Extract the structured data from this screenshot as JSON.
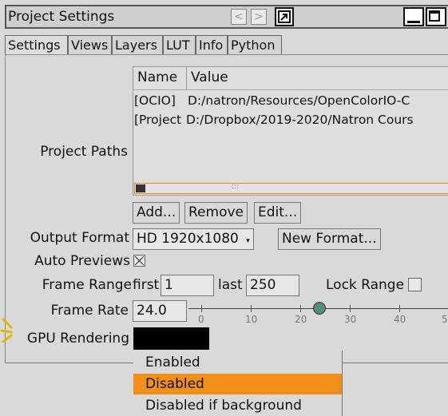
{
  "window": {
    "title": "Project Settings"
  },
  "tabs": [
    "Settings",
    "Views",
    "Layers",
    "LUT",
    "Info",
    "Python"
  ],
  "project_paths": {
    "label": "Project Paths",
    "headers": [
      "Name",
      "Value"
    ],
    "rows": [
      {
        "name": "[OCIO]",
        "value": "D:/natron/Resources/OpenColorIO-C"
      },
      {
        "name": "[Project",
        "value": "D:/Dropbox/2019-2020/Natron Cours"
      }
    ],
    "buttons": {
      "add": "Add...",
      "remove": "Remove",
      "edit": "Edit..."
    }
  },
  "output_format": {
    "label": "Output Format",
    "value": "HD 1920x1080",
    "new_button": "New Format..."
  },
  "auto_previews": {
    "label": "Auto Previews",
    "checked": true
  },
  "frame_range": {
    "label": "Frame Range",
    "first_label": "first",
    "first": "1",
    "last_label": "last",
    "last": "250",
    "lock_label": "Lock Range",
    "lock_checked": false
  },
  "frame_rate": {
    "label": "Frame Rate",
    "value": "24.0",
    "slider_value": 24,
    "ticks": [
      "0",
      "10",
      "20",
      "30",
      "40",
      "5"
    ]
  },
  "gpu_rendering": {
    "label": "GPU Rendering"
  },
  "dropdown": {
    "options": [
      "Enabled",
      "Disabled",
      "Disabled if background"
    ],
    "selected": "Disabled",
    "highlight_color": "#f0901a"
  },
  "icons": [
    "chevron-left-icon",
    "chevron-right-icon",
    "float-window-icon",
    "minimize-icon",
    "maximize-icon",
    "checkbox-x-icon",
    "caret-down-icon"
  ]
}
